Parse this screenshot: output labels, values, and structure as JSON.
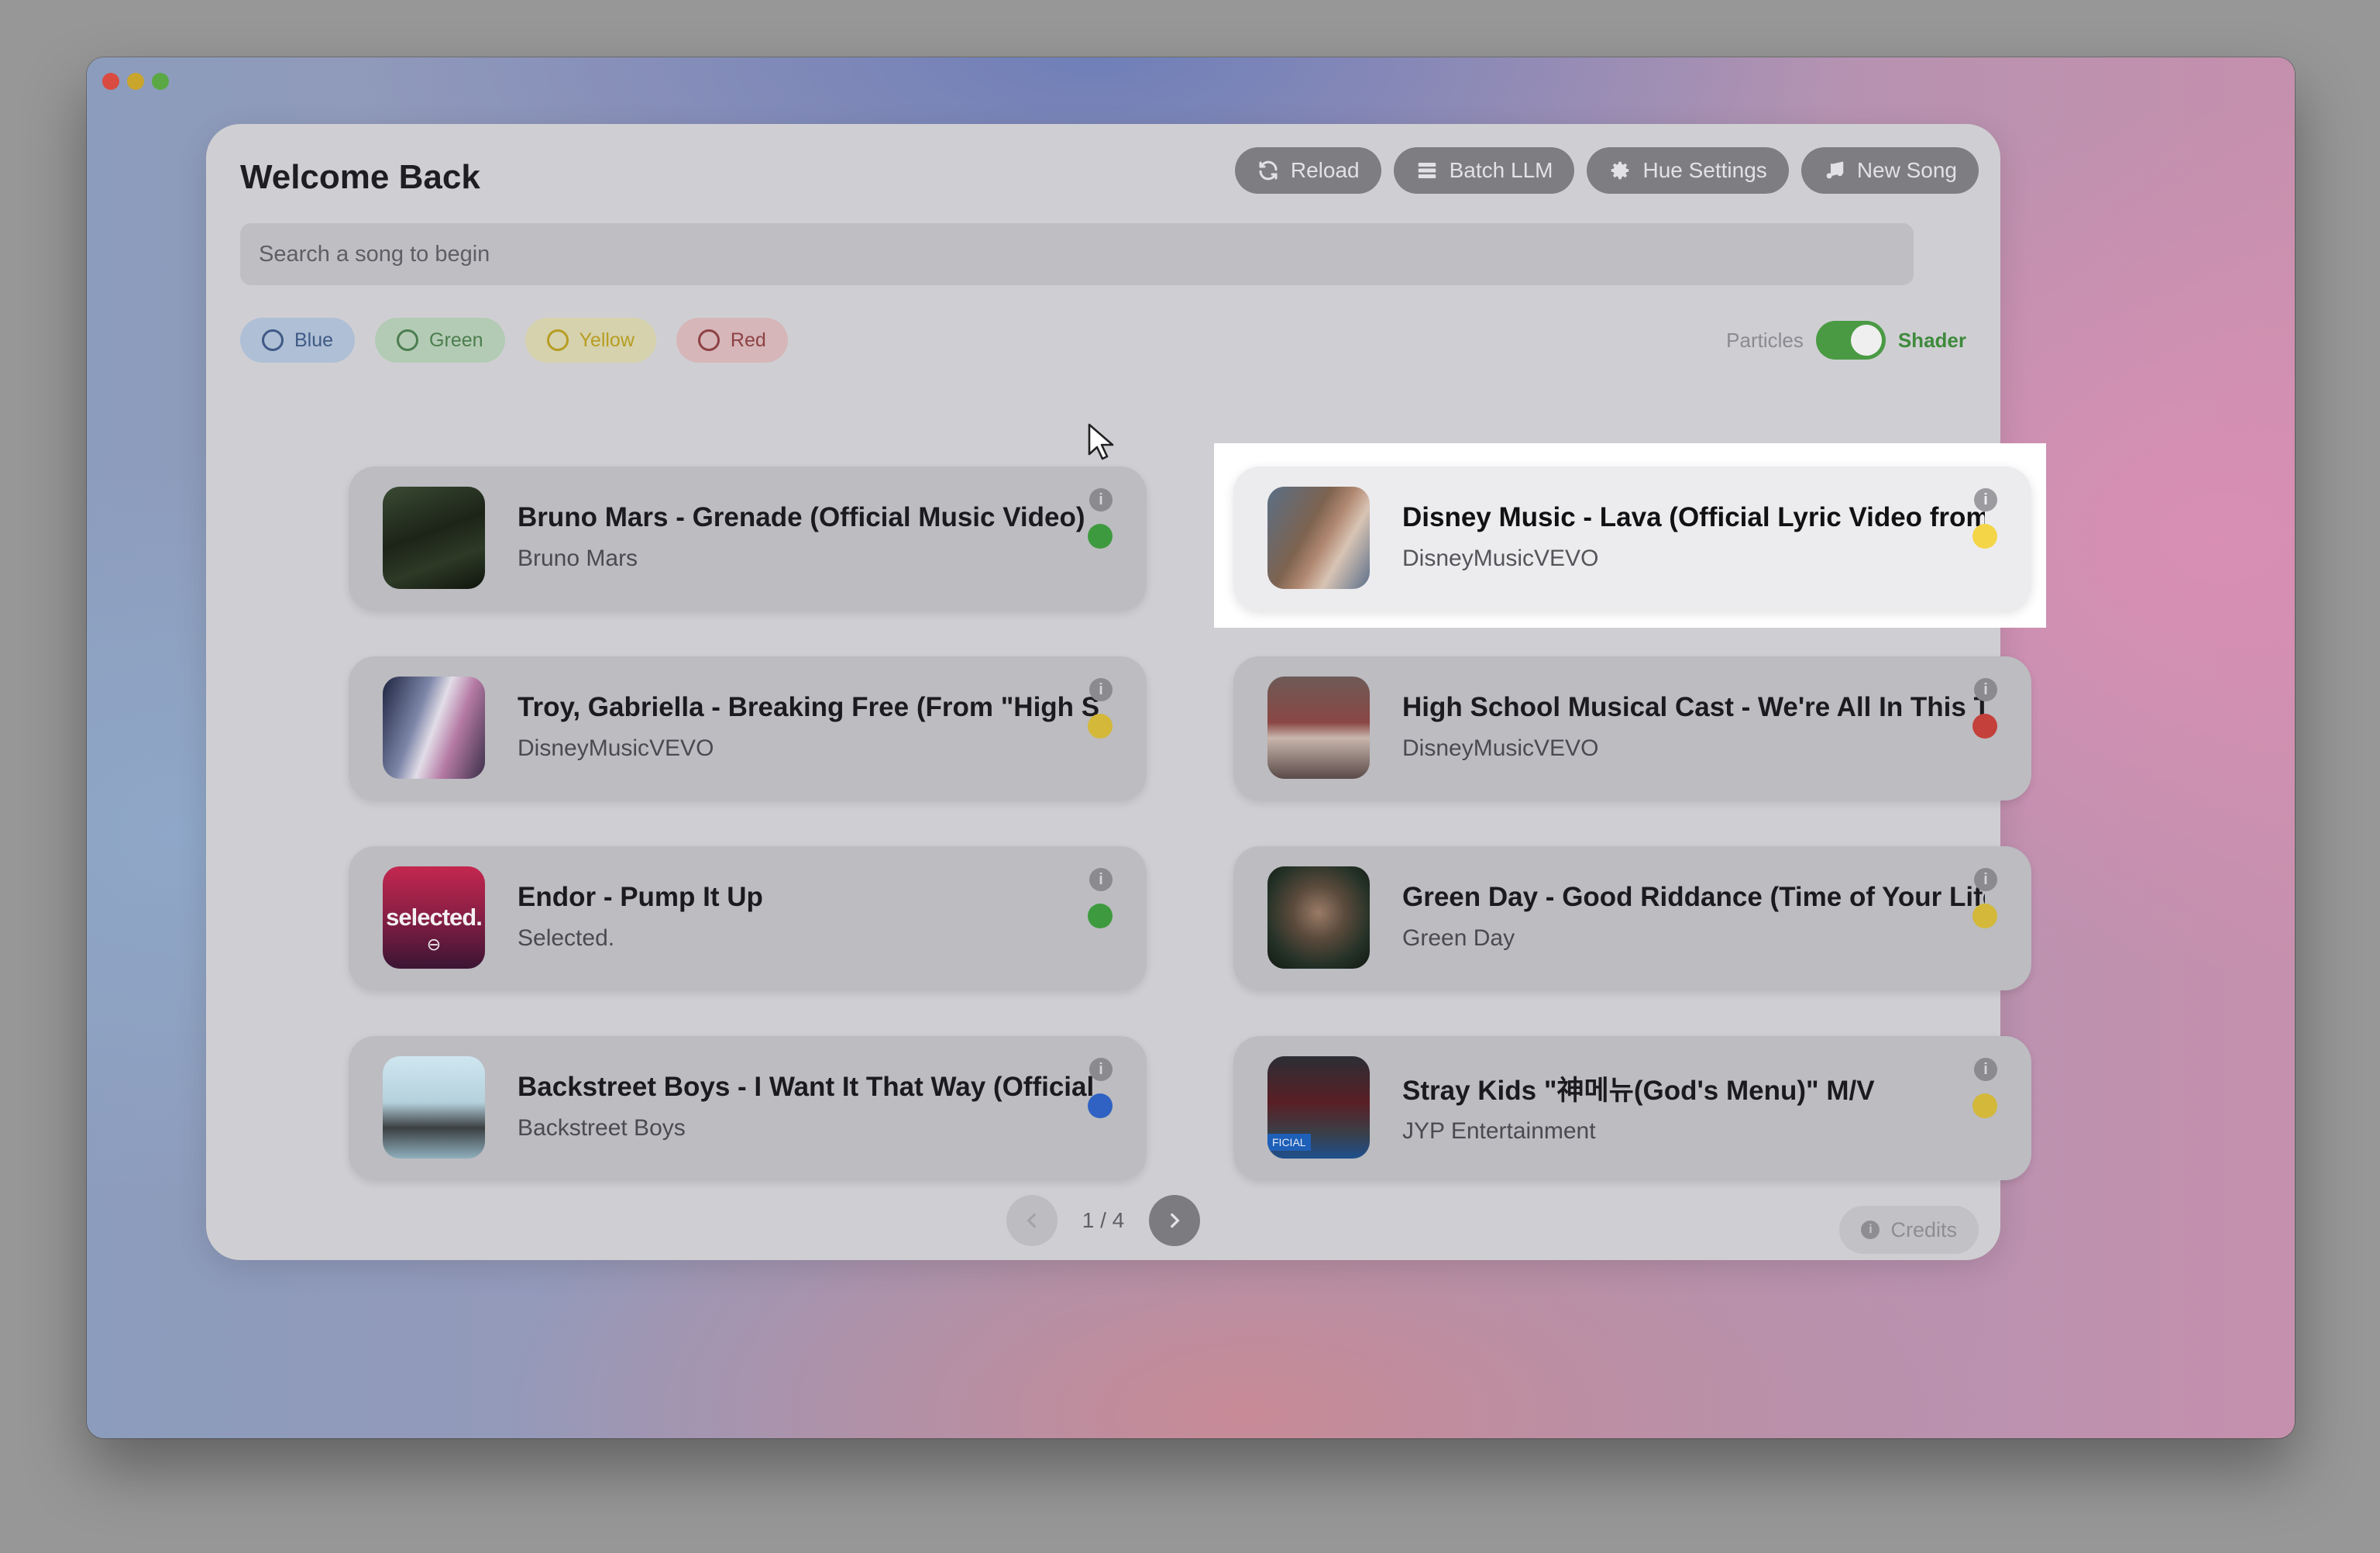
{
  "header": {
    "title": "Welcome Back"
  },
  "toolbar": {
    "reload": {
      "label": "Reload",
      "icon": "refresh-icon"
    },
    "batch": {
      "label": "Batch LLM",
      "icon": "stack-icon"
    },
    "hue": {
      "label": "Hue Settings",
      "icon": "gear-icon"
    },
    "new_song": {
      "label": "New Song",
      "icon": "music-note-icon"
    }
  },
  "search": {
    "placeholder": "Search a song to begin",
    "value": ""
  },
  "filters": [
    {
      "label": "Blue",
      "color": "#3f5a85"
    },
    {
      "label": "Green",
      "color": "#4c7d4f"
    },
    {
      "label": "Yellow",
      "color": "#b79d22"
    },
    {
      "label": "Red",
      "color": "#8d4144"
    }
  ],
  "mode": {
    "off_label": "Particles",
    "on_label": "Shader",
    "checked": true
  },
  "songs": [
    {
      "title": "Bruno Mars - Grenade (Official Music Video)",
      "artist": "Bruno Mars",
      "mood": "green"
    },
    {
      "title": "Disney Music - Lava (Official Lyric Video from \"Lava\")",
      "artist": "DisneyMusicVEVO",
      "mood": "yellow",
      "selected": true
    },
    {
      "title": "Troy, Gabriella - Breaking Free (From \"High School Musical\")",
      "artist": "DisneyMusicVEVO",
      "mood": "yellow"
    },
    {
      "title": "High School Musical Cast - We're All In This Together",
      "artist": "DisneyMusicVEVO",
      "mood": "red"
    },
    {
      "title": "Endor - Pump It Up",
      "artist": "Selected.",
      "mood": "green",
      "thumb_text": "selected."
    },
    {
      "title": "Green Day - Good Riddance (Time of Your Life)",
      "artist": "Green Day",
      "mood": "yellow"
    },
    {
      "title": "Backstreet Boys - I Want It That Way (Official Music Video)",
      "artist": "Backstreet Boys",
      "mood": "blue"
    },
    {
      "title": "Stray Kids \"神메뉴(God's Menu)\" M/V",
      "artist": "JYP Entertainment",
      "mood": "yellow",
      "thumb_text": "FICIAL"
    }
  ],
  "pagination": {
    "label": "1 / 4",
    "current": 1,
    "total": 4
  },
  "footer": {
    "credits_label": "Credits"
  },
  "colors": {
    "green": "#3e9a3e",
    "yellow": "#d4b83a",
    "red": "#c4403a",
    "blue": "#2f62c3"
  }
}
